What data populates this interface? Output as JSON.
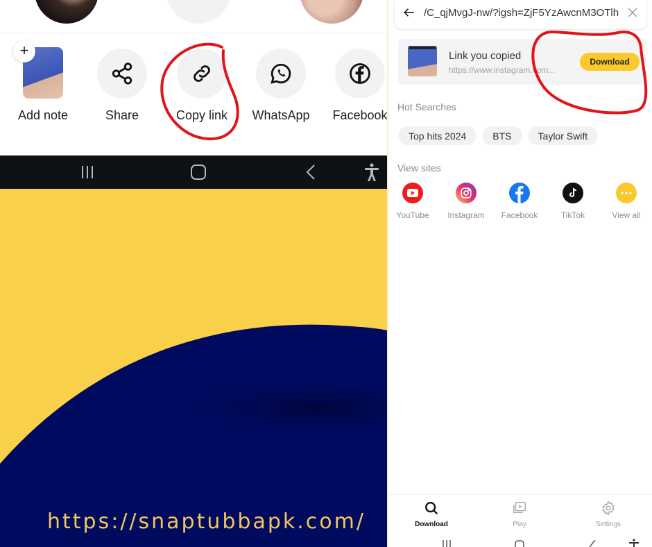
{
  "left_panel": {
    "share_sheet": {
      "items": [
        {
          "label": "Add note",
          "icon": "add-note-thumbnail"
        },
        {
          "label": "Share",
          "icon": "share-icon"
        },
        {
          "label": "Copy link",
          "icon": "link-icon",
          "highlighted": true
        },
        {
          "label": "WhatsApp",
          "icon": "whatsapp-icon"
        },
        {
          "label": "Facebook",
          "icon": "facebook-icon"
        }
      ],
      "add_note_plus": "+"
    },
    "system_nav": [
      "recents",
      "home",
      "back",
      "accessibility"
    ],
    "promo": {
      "url": "https://snaptubbapk.com/",
      "colors": {
        "yellow": "#f9d04a",
        "navy": "#000a5e",
        "url_text": "#f2c65c"
      }
    }
  },
  "right_panel": {
    "url_bar": {
      "value": "/C_qjMvgJ-nw/?igsh=ZjF5YzAwcnM3OTlh"
    },
    "copied_card": {
      "title": "Link you copied",
      "url": "https://www.instagram.com...",
      "download_label": "Download",
      "accent": "#fbc92c"
    },
    "hot_searches": {
      "label": "Hot Searches",
      "chips": [
        "Top hits 2024",
        "BTS",
        "Taylor Swift"
      ]
    },
    "view_sites": {
      "label": "View sites",
      "sites": [
        {
          "label": "YouTube",
          "color": "#ee1c1c"
        },
        {
          "label": "Instagram",
          "color": "#d6249f"
        },
        {
          "label": "Facebook",
          "color": "#1877f2"
        },
        {
          "label": "TikTok",
          "color": "#111111"
        },
        {
          "label": "View all",
          "color": "#fbc92c"
        }
      ]
    },
    "bottom_tabs": [
      {
        "label": "Download",
        "active": true
      },
      {
        "label": "Play",
        "active": false
      },
      {
        "label": "Settings",
        "active": false
      }
    ]
  }
}
